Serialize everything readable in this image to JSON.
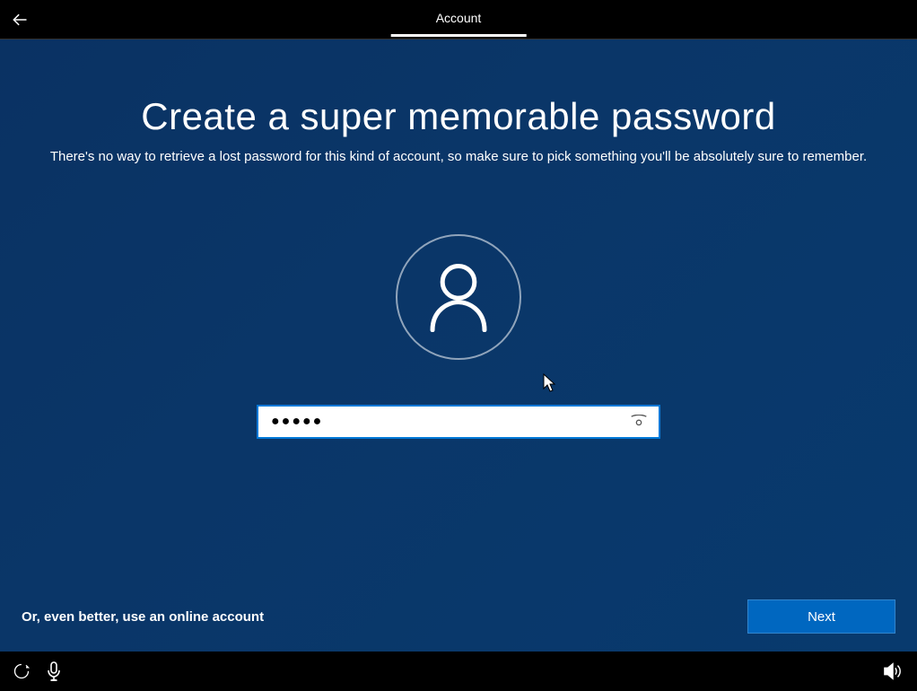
{
  "header": {
    "tab_label": "Account"
  },
  "main": {
    "title": "Create a super memorable password",
    "subtitle": "There's no way to retrieve a lost password for this kind of account, so make sure to pick something you'll be absolutely sure to remember.",
    "password_value": "●●●●●",
    "online_account_link": "Or, even better, use an online account",
    "next_button": "Next"
  }
}
